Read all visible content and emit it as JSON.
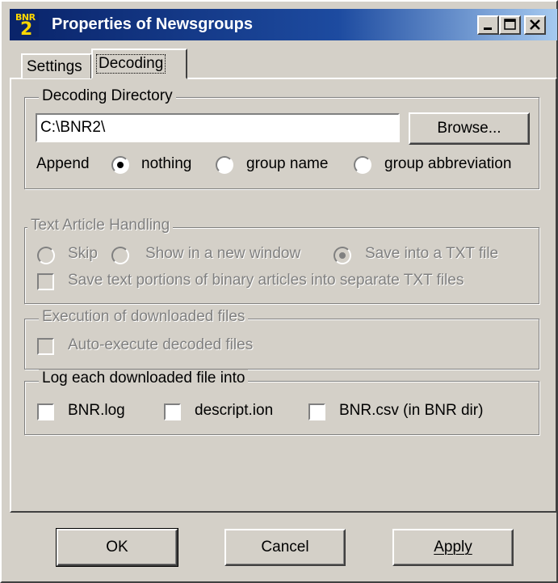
{
  "window": {
    "title": "Properties of Newsgroups",
    "icon": {
      "name": "bnr2-app-icon",
      "top_text": "BNR",
      "bottom_text": "2"
    },
    "buttons": {
      "minimize": "minimize-icon",
      "maximize": "maximize-icon",
      "close": "close-icon"
    },
    "colors": {
      "title_start": "#0a246a",
      "title_end": "#a6caf0",
      "face": "#d4d0c8"
    }
  },
  "tabs": [
    {
      "label": "Settings",
      "active": false
    },
    {
      "label": "Decoding",
      "active": true
    }
  ],
  "decoding_directory": {
    "legend": "Decoding Directory",
    "path_value": "C:\\BNR2\\",
    "browse_label": "Browse...",
    "append_label": "Append",
    "options": [
      {
        "label": "nothing",
        "selected": true
      },
      {
        "label": "group name",
        "selected": false
      },
      {
        "label": "group abbreviation",
        "selected": false
      }
    ]
  },
  "text_article_handling": {
    "legend": "Text Article Handling",
    "enabled": false,
    "options": [
      {
        "label": "Skip",
        "selected": false
      },
      {
        "label": "Show in a new window",
        "selected": false
      },
      {
        "label": "Save into a TXT file",
        "selected": true
      }
    ],
    "separate_txt_label": "Save text portions of binary articles into separate TXT files",
    "separate_txt_checked": false
  },
  "execution": {
    "legend": "Execution of downloaded files",
    "enabled": false,
    "auto_execute_label": "Auto-execute decoded files",
    "auto_execute_checked": false
  },
  "log": {
    "legend": "Log each downloaded file into",
    "options": [
      {
        "label": "BNR.log",
        "checked": false
      },
      {
        "label": "descript.ion",
        "checked": false
      },
      {
        "label": "BNR.csv (in BNR dir)",
        "checked": false
      }
    ]
  },
  "footer": {
    "ok_label": "OK",
    "cancel_label": "Cancel",
    "apply_label": "Apply"
  }
}
